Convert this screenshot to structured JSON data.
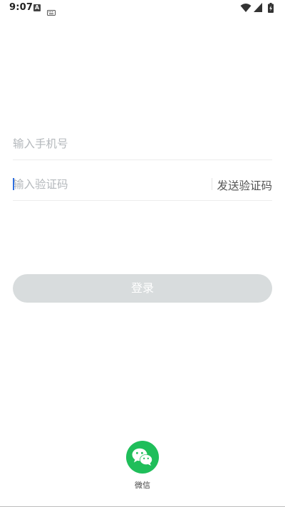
{
  "status_bar": {
    "time": "9:07",
    "a_icon_letter": "A",
    "icons": [
      "a-notification-icon",
      "keyboard-icon",
      "wifi-icon",
      "signal-icon",
      "battery-charging-icon"
    ]
  },
  "login_form": {
    "phone_placeholder": "输入手机号",
    "code_placeholder": "输入验证码",
    "send_code_label": "发送验证码",
    "login_label": "登录"
  },
  "third_party": {
    "wechat_label": "微信",
    "wechat_icon": "wechat-icon"
  },
  "colors": {
    "wechat_green": "#1fbe5a",
    "login_disabled": "#d8dcdd",
    "caret_blue": "#2f6fe0",
    "placeholder": "#b4b8bc"
  }
}
